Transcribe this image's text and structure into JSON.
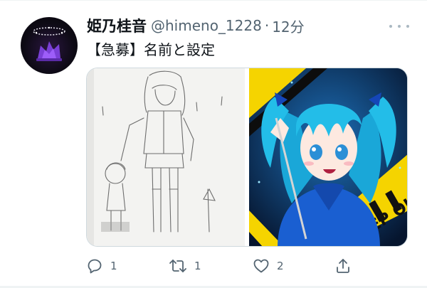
{
  "tweet": {
    "display_name": "姫乃桂音",
    "handle": "@himeno_1228",
    "separator": "·",
    "time": "12分",
    "text": "【急募】名前と設定"
  },
  "avatar": {
    "icon": "avatar-crown-icon"
  },
  "more": {
    "icon": "more-dots-icon"
  },
  "media": [
    {
      "name": "pencil-sketch-image",
      "subject": "character-sketch"
    },
    {
      "name": "digital-illustration-image",
      "subject": "blue-haired-girl",
      "sign_text": "KEEP OUT"
    }
  ],
  "actions": {
    "reply_count": "1",
    "retweet_count": "1",
    "like_count": "2"
  },
  "colors": {
    "text": "#0f1419",
    "muted": "#536471",
    "divider": "#eff3f4",
    "caution_yellow": "#f5d400",
    "hair_blue": "#21b8e0",
    "jacket_blue": "#1a5fd1"
  }
}
